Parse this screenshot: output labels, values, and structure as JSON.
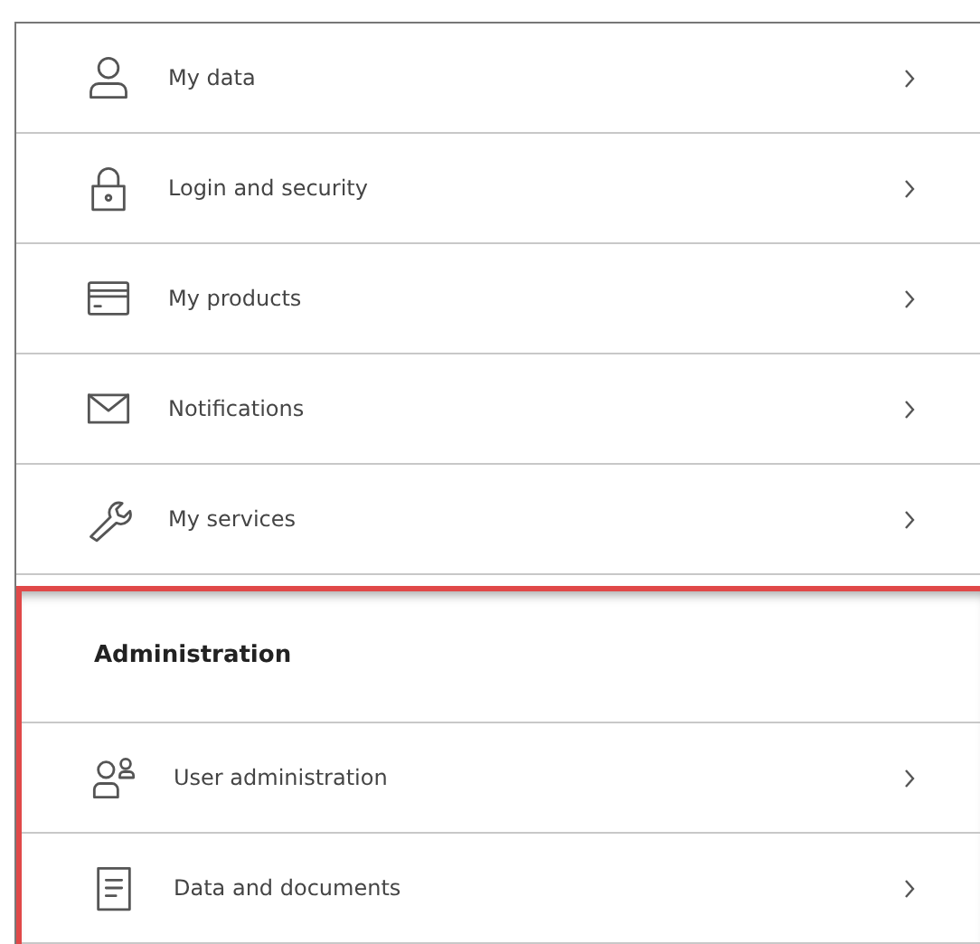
{
  "menu_items": [
    {
      "label": "My data",
      "kind": "person"
    },
    {
      "label": "Login and security",
      "kind": "lock"
    },
    {
      "label": "My products",
      "kind": "card"
    },
    {
      "label": "Notifications",
      "kind": "mail"
    },
    {
      "label": "My services",
      "kind": "wrench"
    }
  ],
  "administration": {
    "title": "Administration",
    "highlighted": true,
    "items": [
      {
        "label": "User administration",
        "kind": "users"
      },
      {
        "label": "Data and documents",
        "kind": "document"
      }
    ]
  }
}
